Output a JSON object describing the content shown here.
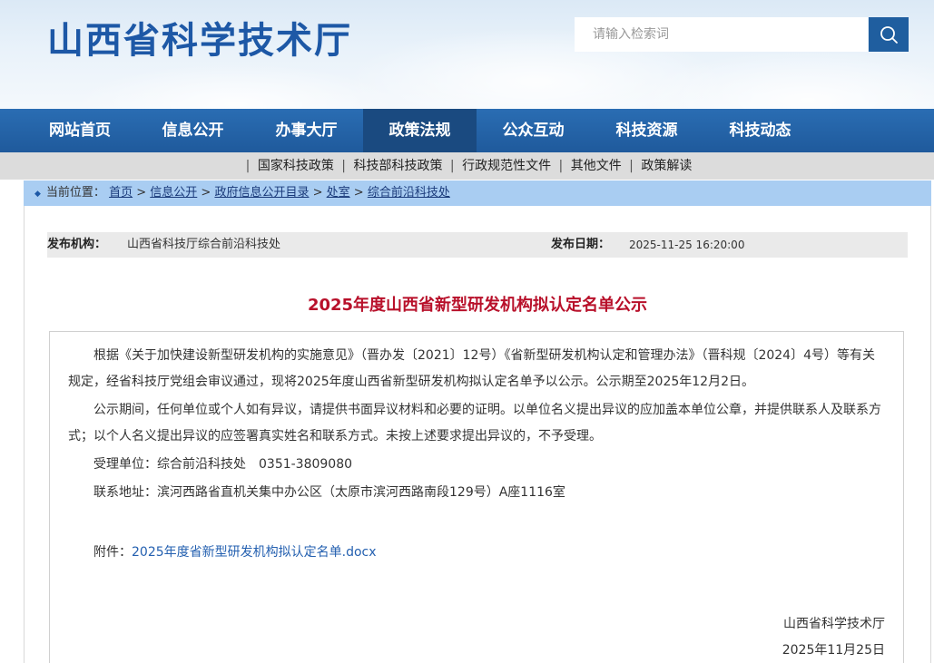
{
  "header": {
    "site_title": "山西省科学技术厅",
    "search_placeholder": "请输入检索词",
    "search_icon": "search-icon"
  },
  "nav": {
    "items": [
      {
        "label": "网站首页"
      },
      {
        "label": "信息公开"
      },
      {
        "label": "办事大厅"
      },
      {
        "label": "政策法规"
      },
      {
        "label": "公众互动"
      },
      {
        "label": "科技资源"
      },
      {
        "label": "科技动态"
      }
    ],
    "active_index": 3
  },
  "subnav": {
    "items": [
      "国家科技政策",
      "科技部科技政策",
      "行政规范性文件",
      "其他文件",
      "政策解读"
    ]
  },
  "breadcrumb": {
    "prefix": "当前位置：",
    "items": [
      "首页",
      "信息公开",
      "政府信息公开目录",
      "处室",
      "综合前沿科技处"
    ]
  },
  "meta": {
    "publisher_label": "发布机构：",
    "publisher_value": "山西省科技厅综合前沿科技处",
    "date_label": "发布日期：",
    "date_value": "2025-11-25 16:20:00"
  },
  "article": {
    "title": "2025年度山西省新型研发机构拟认定名单公示",
    "para1": "根据《关于加快建设新型研发机构的实施意见》（晋办发〔2021〕12号）《省新型研发机构认定和管理办法》（晋科规〔2024〕4号）等有关规定，经省科技厅党组会审议通过，现将2025年度山西省新型研发机构拟认定名单予以公示。公示期至2025年12月2日。",
    "para2": "公示期间，任何单位或个人如有异议，请提供书面异议材料和必要的证明。以单位名义提出异议的应加盖本单位公章，并提供联系人及联系方式；以个人名义提出异议的应签署真实姓名和联系方式。未按上述要求提出异议的，不予受理。",
    "para3": "受理单位：综合前沿科技处　0351-3809080",
    "para4": "联系地址：滨河西路省直机关集中办公区（太原市滨河西路南段129号）A座1116室",
    "attachment_label": "附件：",
    "attachment_link": "2025年度省新型研发机构拟认定名单.docx",
    "signature_org": "山西省科学技术厅",
    "signature_date": "2025年11月25日"
  },
  "colors": {
    "brand_blue": "#1d58a6",
    "nav_blue": "#1f5a9c",
    "title_red": "#b8102a",
    "breadcrumb_bg": "#a9cdf2"
  }
}
